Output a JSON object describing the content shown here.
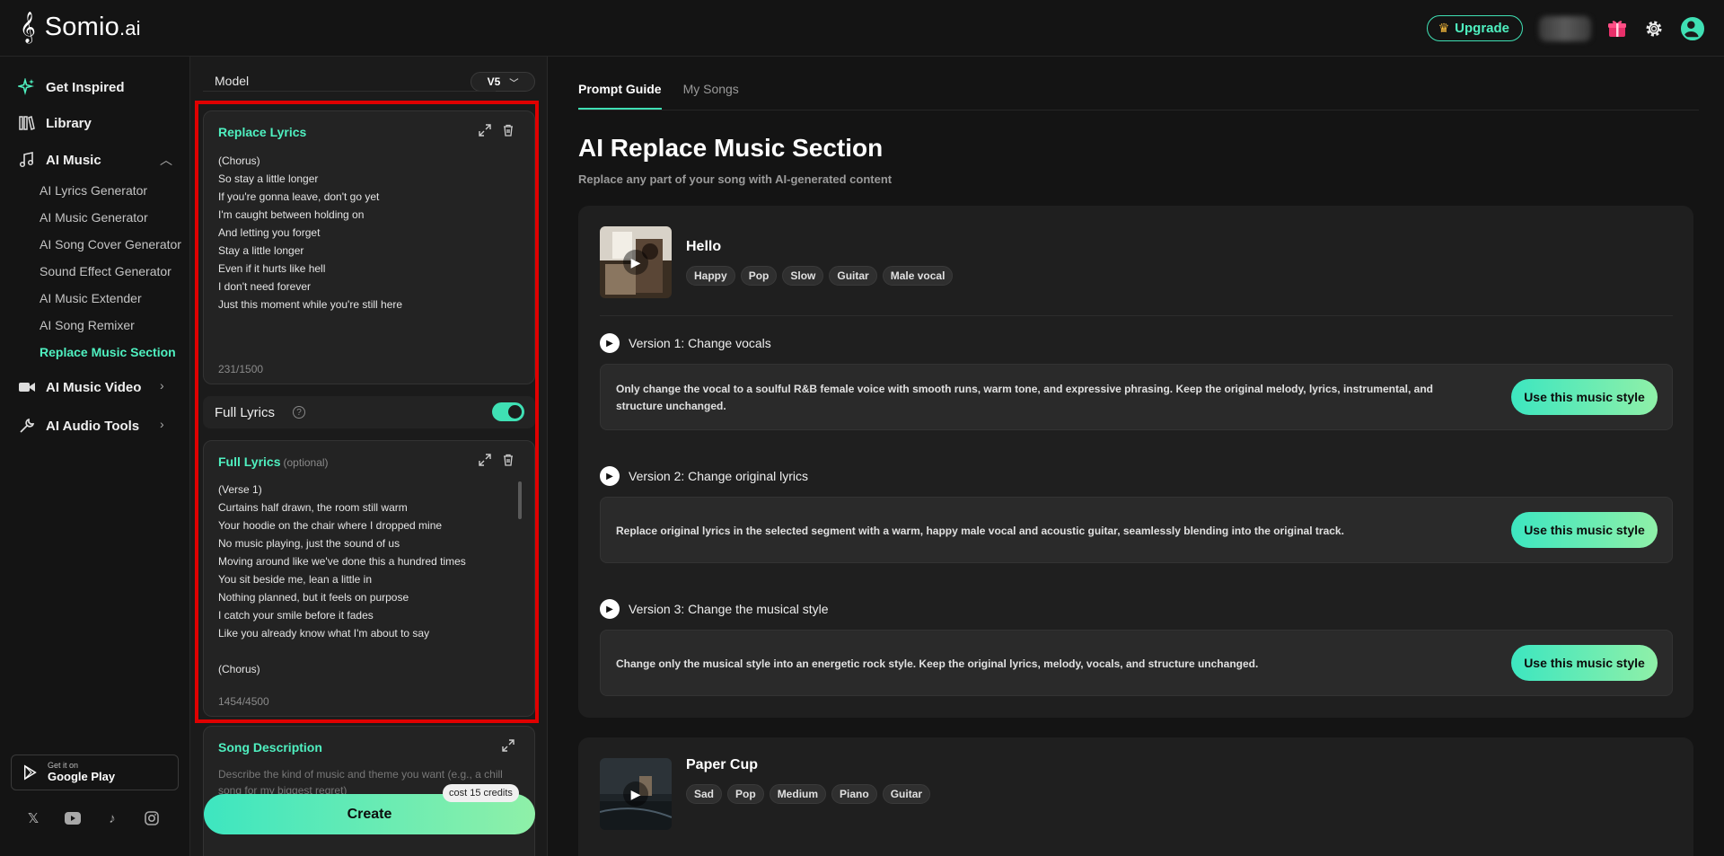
{
  "app": {
    "logo_text": "Somio",
    "logo_suffix": ".ai"
  },
  "topbar": {
    "upgrade_label": "Upgrade"
  },
  "sidebar": {
    "items": [
      {
        "label": "Get Inspired",
        "icon": "sparkle-icon"
      },
      {
        "label": "Library",
        "icon": "library-icon"
      },
      {
        "label": "AI Music",
        "icon": "music-note-icon",
        "expanded": true
      },
      {
        "label": "AI Music Video",
        "icon": "video-icon"
      },
      {
        "label": "AI Audio Tools",
        "icon": "wrench-icon"
      }
    ],
    "subitems": [
      "AI Lyrics Generator",
      "AI Music Generator",
      "AI Song Cover Generator",
      "Sound Effect Generator",
      "AI Music Extender",
      "AI Song Remixer",
      "Replace Music Section"
    ],
    "active_subitem": "Replace Music Section",
    "google_play": {
      "small": "Get it on",
      "big": "Google Play"
    },
    "socials": [
      "x-icon",
      "youtube-icon",
      "tiktok-icon",
      "instagram-icon"
    ]
  },
  "form": {
    "model_label": "Model",
    "model_value": "V5",
    "replace_lyrics": {
      "title": "Replace Lyrics",
      "text": "(Chorus)\nSo stay a little longer\nIf you're gonna leave, don't go yet\nI'm caught between holding on\nAnd letting you forget\nStay a little longer\nEven if it hurts like hell\nI don't need forever\nJust this moment while you're still here",
      "counter": "231/1500"
    },
    "full_lyrics_toggle": {
      "label": "Full Lyrics",
      "on": true
    },
    "full_lyrics": {
      "title": "Full Lyrics",
      "optional": "(optional)",
      "text": "(Verse 1)\nCurtains half drawn, the room still warm\nYour hoodie on the chair where I dropped mine\nNo music playing, just the sound of us\nMoving around like we've done this a hundred times\nYou sit beside me, lean a little in\nNothing planned, but it feels on purpose\nI catch your smile before it fades\nLike you already know what I'm about to say\n\n(Chorus)",
      "counter": "1454/4500"
    },
    "song_description": {
      "title": "Song Description",
      "placeholder": "Describe the kind of music and theme you want (e.g., a chill song for my biggest regret)"
    },
    "cost_label": "cost 15 credits",
    "create_label": "Create"
  },
  "content": {
    "tabs": [
      "Prompt Guide",
      "My Songs"
    ],
    "active_tab": "Prompt Guide",
    "title": "AI Replace Music Section",
    "subtitle": "Replace any part of your song with AI-generated content",
    "songs": [
      {
        "title": "Hello",
        "tags": [
          "Happy",
          "Pop",
          "Slow",
          "Guitar",
          "Male vocal"
        ],
        "versions": [
          {
            "heading": "Version 1: Change vocals",
            "description": "Only change the vocal to a soulful R&B female voice with smooth runs, warm tone, and expressive phrasing. Keep the original melody, lyrics, instrumental, and structure unchanged.",
            "button": "Use this music style"
          },
          {
            "heading": "Version 2: Change original lyrics",
            "description": "Replace original lyrics in the selected segment with a warm, happy male vocal and acoustic guitar, seamlessly blending into the original track.",
            "button": "Use this music style"
          },
          {
            "heading": "Version 3: Change the musical style",
            "description": "Change only the musical style into an energetic rock style. Keep the original lyrics, melody, vocals, and structure unchanged.",
            "button": "Use this music style"
          }
        ]
      },
      {
        "title": "Paper Cup",
        "tags": [
          "Sad",
          "Pop",
          "Medium",
          "Piano",
          "Guitar"
        ]
      }
    ]
  },
  "colors": {
    "accent": "#3fe0b4",
    "highlight": "#e00000",
    "background": "#141414"
  }
}
